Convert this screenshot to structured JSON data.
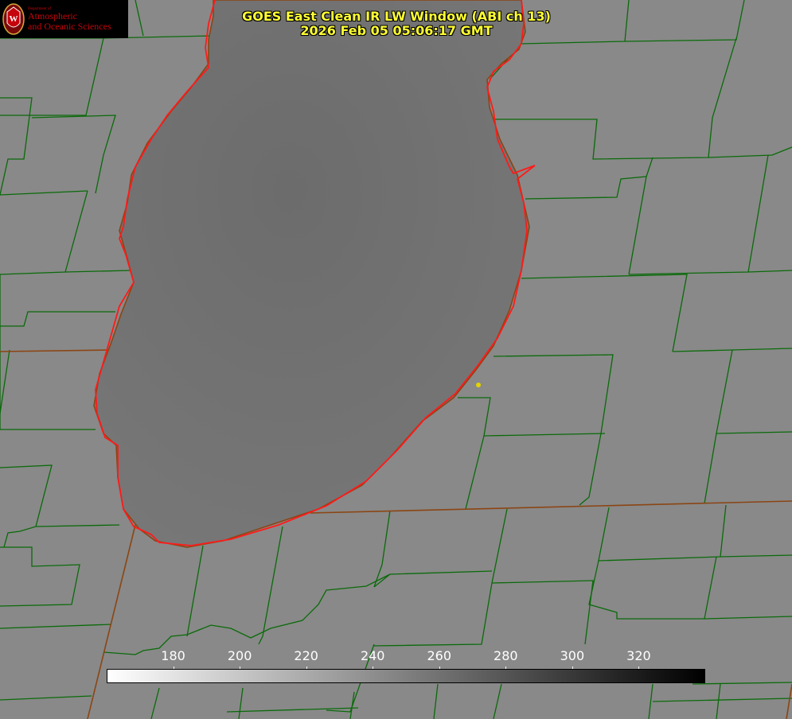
{
  "title": {
    "line1": "GOES East Clean IR LW Window (ABI ch 13)",
    "line2": "2026 Feb 05 05:06:17 GMT"
  },
  "logo": {
    "dept": "Department of",
    "line1": "Atmospheric",
    "line2": "and Oceanic Sciences",
    "seal_letter": "W"
  },
  "colorbar": {
    "min": 160,
    "max": 340,
    "ticks": [
      "180",
      "200",
      "220",
      "240",
      "260",
      "280",
      "300",
      "320"
    ],
    "gradient_start": "#ffffff",
    "gradient_end": "#000000"
  },
  "colors": {
    "background": "#8a8a8a",
    "lake": "#727272",
    "county_lines": "#006400",
    "state_lines": "#8b4513",
    "coastline": "#ff0000",
    "title": "#ffff33",
    "marker": "#e6d200",
    "logo_red": "#c5050c"
  }
}
